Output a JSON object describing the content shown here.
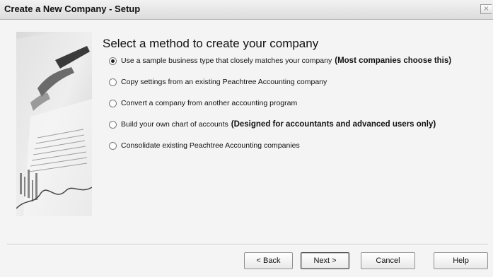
{
  "window": {
    "title": "Create a New Company - Setup",
    "close_glyph": "×"
  },
  "heading": "Select a method to create your company",
  "options": [
    {
      "label": "Use a sample business type that closely matches your company",
      "emphasis": "(Most companies choose this)",
      "selected": true
    },
    {
      "label": "Copy settings from an existing Peachtree Accounting company",
      "emphasis": "",
      "selected": false
    },
    {
      "label": "Convert a company from another accounting program",
      "emphasis": "",
      "selected": false
    },
    {
      "label": "Build your own chart of accounts",
      "emphasis": "(Designed for accountants and advanced users only)",
      "selected": false
    },
    {
      "label": "Consolidate existing Peachtree Accounting companies",
      "emphasis": "",
      "selected": false
    }
  ],
  "buttons": {
    "back": "< Back",
    "next": "Next >",
    "cancel": "Cancel",
    "help": "Help"
  },
  "icons": {
    "close": "close-icon",
    "radio": "radio-icon"
  }
}
